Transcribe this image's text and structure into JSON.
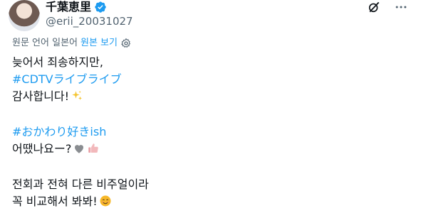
{
  "author": {
    "display_name": "千葉恵里",
    "handle": "@erii_20031027"
  },
  "translation_bar": {
    "source_text": "원문 언어 일본어",
    "toggle_label": "원본 보기"
  },
  "tweet": {
    "line1": "늦어서 죄송하지만,",
    "hashtag1": "#CDTVライブライブ",
    "line3": "감사합니다!",
    "hashtag2": "#おかわり好きish",
    "line5": "어땠나요ー?",
    "line6": "전회과 전혀 다른 비주얼이라",
    "line7": "꼭 비교해서 봐봐!"
  },
  "icons": {
    "verified": "verified-badge-icon",
    "grok": "grok-icon",
    "more": "more-icon",
    "settings": "gear-icon",
    "sparkles": "sparkles-emoji",
    "grey_heart": "grey-heart-emoji",
    "thumbs_up": "thumbs-up-emoji",
    "smile": "smiling-face-emoji"
  },
  "colors": {
    "link": "#1d9bf0",
    "secondary_text": "#536471",
    "primary_text": "#0f1419"
  }
}
